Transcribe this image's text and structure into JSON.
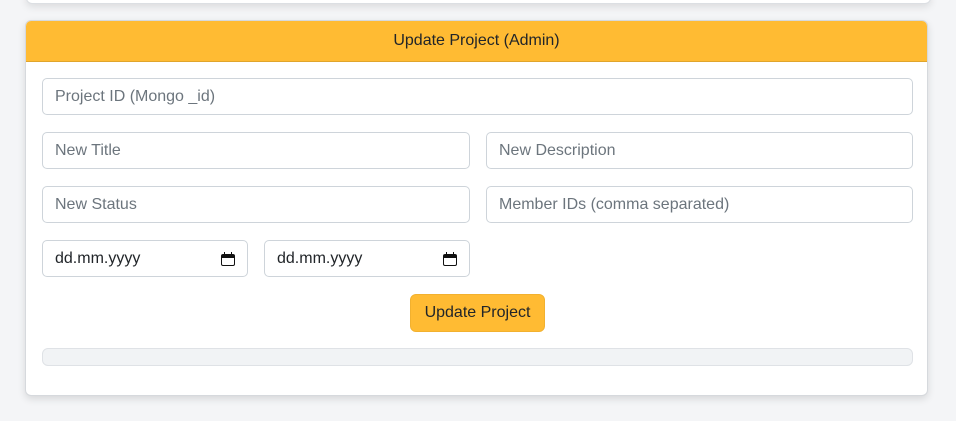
{
  "header": {
    "title": "Update Project (Admin)"
  },
  "form": {
    "project_id_placeholder": "Project ID (Mongo _id)",
    "new_title_placeholder": "New Title",
    "new_description_placeholder": "New Description",
    "new_status_placeholder": "New Status",
    "member_ids_placeholder": "Member IDs (comma separated)",
    "start_date_value": "dd.mm.yyyy",
    "end_date_value": "dd.mm.yyyy",
    "submit_label": "Update Project"
  },
  "colors": {
    "accent": "#ffbb33",
    "page_background": "#f4f5f7"
  },
  "icons": {
    "date_picker": "calendar-icon"
  }
}
